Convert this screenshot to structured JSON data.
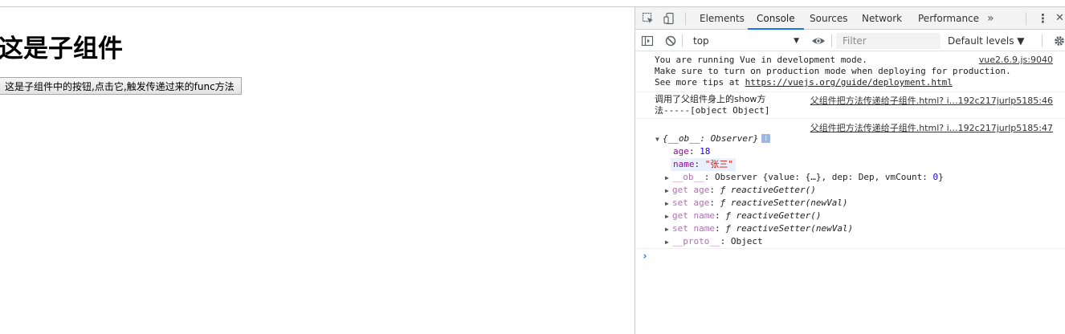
{
  "page": {
    "heading": "这是子组件",
    "child_button_label": "这是子组件中的按钮,点击它,触发传递过来的func方法"
  },
  "devtools": {
    "tabs": [
      {
        "label": "Elements"
      },
      {
        "label": "Console"
      },
      {
        "label": "Sources"
      },
      {
        "label": "Network"
      },
      {
        "label": "Performance"
      }
    ],
    "more_tabs_glyph": "»",
    "kebab_glyph": "⋮",
    "close_glyph": "✕",
    "context_select": "top",
    "filter_placeholder": "Filter",
    "levels_label": "Default levels ▼",
    "active_tab": "Console",
    "accent_color": "#1a73e8"
  },
  "console": {
    "vue_message": {
      "line1": "You are running Vue in development mode.",
      "line2": "Make sure to turn on production mode when deploying for production.",
      "line3_prefix": "See more tips at ",
      "line3_url": "https://vuejs.org/guide/deployment.html",
      "source": "vue2.6.9.js:9040"
    },
    "show_message": {
      "line1": "调用了父组件身上的show方",
      "line2": "法-----[object Object]",
      "source": "父组件把方法传递给子组件.html? i…192c217jurlp5185:46"
    },
    "object_message": {
      "source": "父组件把方法传递给子组件.html? i…192c217jurlp5185:47",
      "summary": "{__ob__: Observer}",
      "info_badge": "i",
      "props": [
        {
          "key": "age",
          "value": "18",
          "kind": "number"
        },
        {
          "key": "name",
          "value": "\"张三\"",
          "kind": "string"
        }
      ],
      "ob_key": "__ob__",
      "ob_value_prefix": "Observer {value: {…}, dep: Dep, vmCount: ",
      "ob_value_count": "0",
      "ob_value_suffix": "}",
      "accessors": [
        {
          "key": "get age",
          "fn": "reactiveGetter()"
        },
        {
          "key": "set age",
          "fn": "reactiveSetter(newVal)"
        },
        {
          "key": "get name",
          "fn": "reactiveGetter()"
        },
        {
          "key": "set name",
          "fn": "reactiveSetter(newVal)"
        }
      ],
      "proto_key": "__proto__",
      "proto_value": "Object"
    },
    "prompt_glyph": "›"
  }
}
